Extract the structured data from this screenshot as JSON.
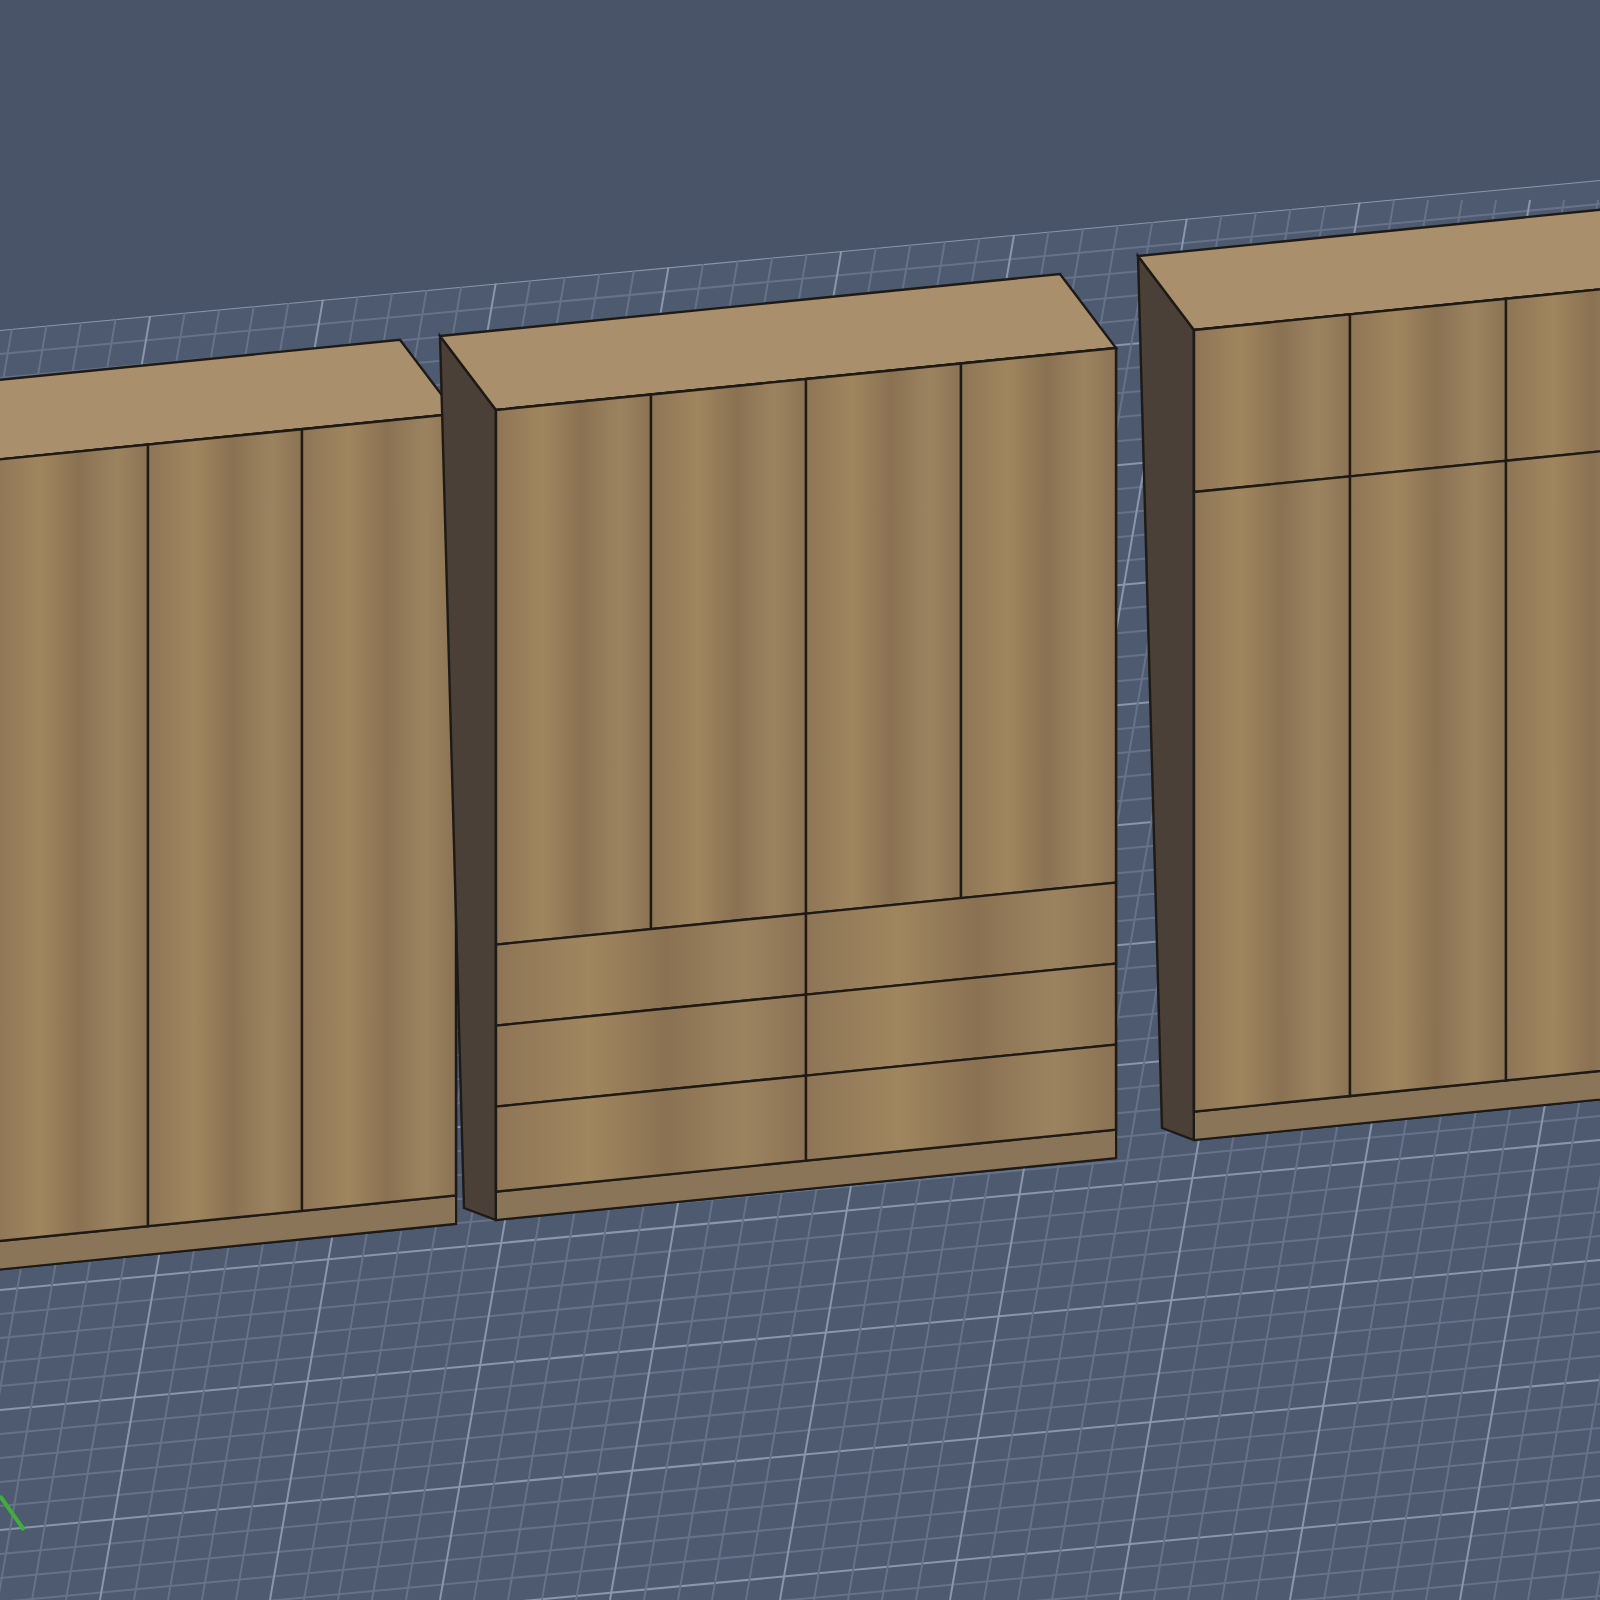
{
  "viewport": {
    "wardrobes": [
      {
        "kind": "three-door"
      },
      {
        "kind": "four-door-drawers"
      },
      {
        "kind": "top-cabinets"
      }
    ]
  }
}
